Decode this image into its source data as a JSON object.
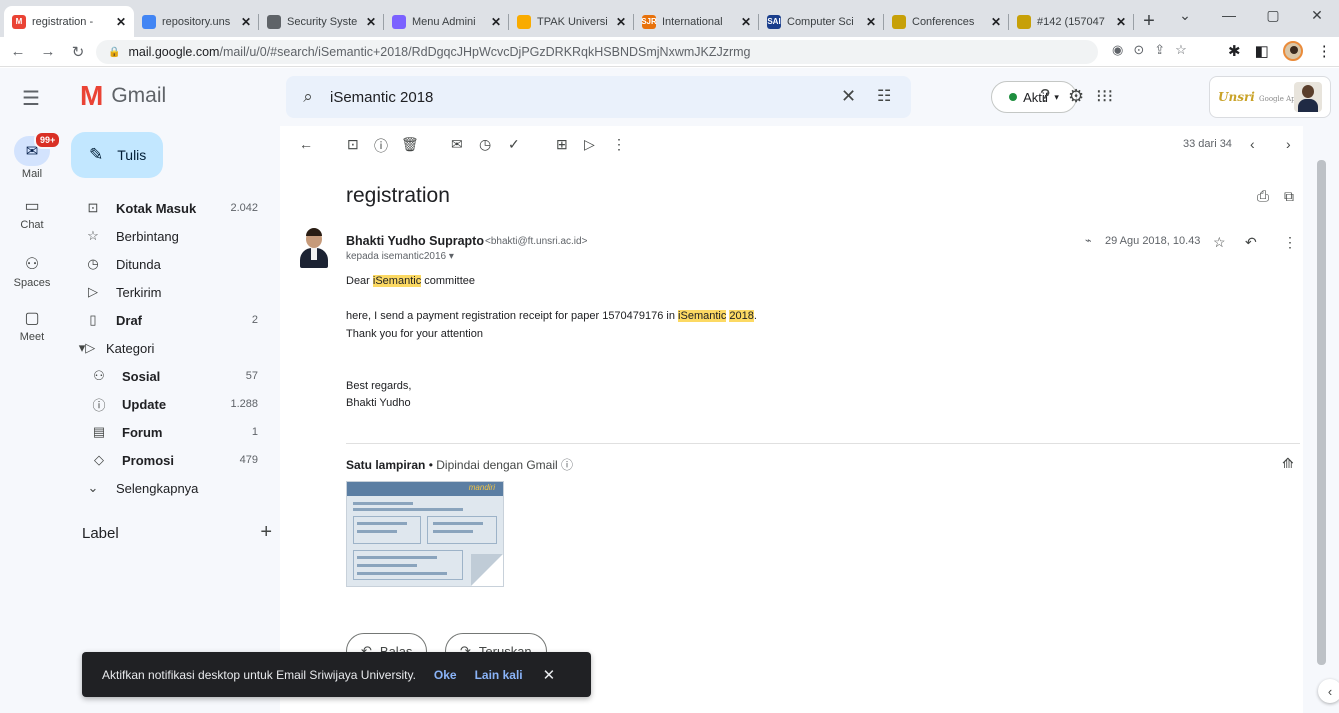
{
  "browser": {
    "tabs": [
      {
        "title": "registration - ",
        "fav": "M",
        "favcolor": "#ea4335",
        "active": true
      },
      {
        "title": "repository.uns",
        "fav": "",
        "favcolor": "#4285f4",
        "active": false
      },
      {
        "title": "Security Syste",
        "fav": "",
        "favcolor": "#5f6368",
        "active": false
      },
      {
        "title": "Menu Admini",
        "fav": "",
        "favcolor": "#7b61ff",
        "active": false
      },
      {
        "title": "TPAK Universi",
        "fav": "",
        "favcolor": "#f9ab00",
        "active": false
      },
      {
        "title": "International",
        "fav": "SJR",
        "favcolor": "#e8710a",
        "active": false
      },
      {
        "title": "Computer Sci",
        "fav": "SAI",
        "favcolor": "#1a3e8c",
        "active": false
      },
      {
        "title": "Conferences",
        "fav": "",
        "favcolor": "#c7a008",
        "active": false
      },
      {
        "title": "#142 (157047",
        "fav": "",
        "favcolor": "#c7a008",
        "active": false
      }
    ],
    "new_tab": "+",
    "url_host": "mail.google.com",
    "url_rest": "/mail/u/0/#search/iSemantic+2018/RdDgqcJHpWcvcDjPGzDRKRqkHSBNDSmjNxwmJKZJzrmg"
  },
  "gmail": {
    "logo_letter": "M",
    "logo_text": "Gmail",
    "search_value": "iSemantic 2018",
    "status_label": "Aktif",
    "status_color": "#1e8e3e",
    "org_logo": "Unsri",
    "org_logo_sub": "Google Apps"
  },
  "rail": {
    "mail_badge": "99+",
    "items": [
      {
        "label": "Mail",
        "icon": "mail-icon"
      },
      {
        "label": "Chat",
        "icon": "chat-icon"
      },
      {
        "label": "Spaces",
        "icon": "spaces-icon"
      },
      {
        "label": "Meet",
        "icon": "meet-icon"
      }
    ]
  },
  "nav": {
    "compose_label": "Tulis",
    "items": [
      {
        "label": "Kotak Masuk",
        "count": "2.042",
        "icon": "inbox-icon"
      },
      {
        "label": "Berbintang",
        "count": "",
        "icon": "star-icon"
      },
      {
        "label": "Ditunda",
        "count": "",
        "icon": "clock-icon"
      },
      {
        "label": "Terkirim",
        "count": "",
        "icon": "send-icon"
      },
      {
        "label": "Draf",
        "count": "2",
        "icon": "draft-icon"
      },
      {
        "label": "Kategori",
        "count": "",
        "icon": "label-icon"
      },
      {
        "label": "Sosial",
        "count": "57",
        "icon": "people-icon"
      },
      {
        "label": "Update",
        "count": "1.288",
        "icon": "info-icon"
      },
      {
        "label": "Forum",
        "count": "1",
        "icon": "forum-icon"
      },
      {
        "label": "Promosi",
        "count": "479",
        "icon": "tag-icon"
      },
      {
        "label": "Selengkapnya",
        "count": "",
        "icon": "chevron-down-icon"
      }
    ],
    "label_header": "Label"
  },
  "email": {
    "pager": "33 dari 34",
    "subject": "registration",
    "from_name": "Bhakti Yudho Suprapto",
    "from_email": "<bhakti@ft.unsri.ac.id>",
    "to_line": "kepada isemantic2016",
    "date": "29 Agu 2018, 10.43",
    "body": {
      "greeting_pre": "Dear ",
      "greeting_hl": "iSemantic",
      "greeting_post": " committee",
      "line1_pre": "here, I send a payment registration receipt for paper 1570479176 in ",
      "line1_hl1": "iSemantic",
      "line1_hl2": "2018",
      "line1_post": ".",
      "line2": "Thank you for your attention",
      "closing": "Best regards,",
      "signature": "Bhakti Yudho"
    },
    "attachments_title": "Satu lampiran",
    "attachments_scan": "Dipindai dengan Gmail",
    "thumb_brand": "mandiri",
    "reply_label": "Balas",
    "forward_label": "Teruskan"
  },
  "snackbar": {
    "message": "Aktifkan notifikasi desktop untuk Email Sriwijaya University.",
    "ok_label": "Oke",
    "later_label": "Lain kali"
  }
}
